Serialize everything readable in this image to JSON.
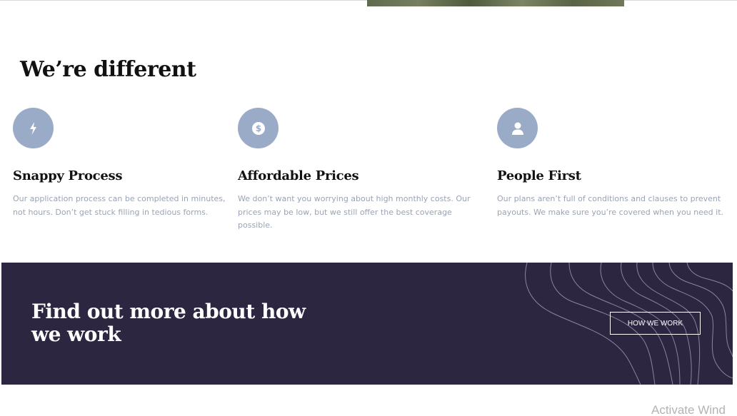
{
  "section": {
    "title": "We’re different"
  },
  "features": [
    {
      "icon": "lightning-icon",
      "title": "Snappy Process",
      "description": "Our application process can be completed in minutes, not hours. Don’t get stuck filling in tedious forms."
    },
    {
      "icon": "dollar-coin-icon",
      "title": "Affordable Prices",
      "description": "We don’t want you worrying about high monthly costs. Our prices may be low, but we still offer the best coverage possible."
    },
    {
      "icon": "person-icon",
      "title": "People First",
      "description": "Our plans aren’t full of conditions and clauses to prevent payouts. We make sure you’re covered when you need it."
    }
  ],
  "cta": {
    "heading": "Find out more about how we work",
    "button_label": "How we work"
  },
  "watermark": {
    "text": "Activate Wind"
  },
  "colors": {
    "icon_circle": "#9aabc8",
    "cta_background": "#2c2640",
    "body_text": "#9aa3b5"
  }
}
